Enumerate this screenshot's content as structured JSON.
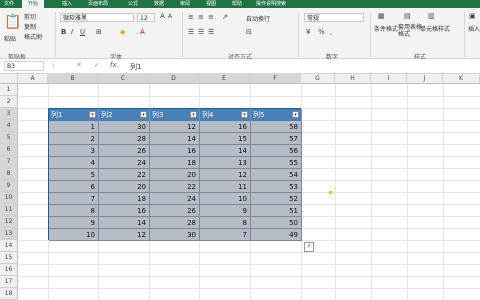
{
  "tabs": [
    "文件",
    "开始",
    "插入",
    "页面布局",
    "公式",
    "数据",
    "审阅",
    "视图",
    "帮助",
    "操作说明搜索"
  ],
  "ribbon": {
    "clipboard": {
      "paste": "粘贴",
      "cut": "剪切",
      "copy": "复制",
      "format_painter": "格式刷",
      "group": "剪贴板"
    },
    "font": {
      "name": "微软雅黑",
      "size": "12",
      "group": "字体"
    },
    "alignment": {
      "wrap": "自动换行",
      "group": "对齐方式"
    },
    "number": {
      "format": "常规",
      "group": "数字"
    },
    "styles": {
      "conditional": "条件格式",
      "table": "套用表格格式",
      "cell": "单元格样式",
      "group": "样式"
    },
    "cells": {
      "insert": "插入"
    }
  },
  "formula_bar": {
    "name_box": "B3",
    "fx": "fx",
    "content": "列1"
  },
  "columns": [
    "A",
    "B",
    "C",
    "D",
    "E",
    "F",
    "G",
    "H",
    "I",
    "J",
    "K"
  ],
  "rows": [
    "1",
    "2",
    "3",
    "4",
    "5",
    "6",
    "7",
    "8",
    "9",
    "10",
    "11",
    "12",
    "13",
    "14",
    "15",
    "16",
    "17",
    "18"
  ],
  "table": {
    "headers": [
      "列1",
      "列2",
      "列3",
      "列4",
      "列5"
    ],
    "rows": [
      [
        1,
        30,
        12,
        16,
        58
      ],
      [
        2,
        28,
        14,
        15,
        57
      ],
      [
        3,
        26,
        16,
        14,
        56
      ],
      [
        4,
        24,
        18,
        13,
        55
      ],
      [
        5,
        22,
        20,
        12,
        54
      ],
      [
        6,
        20,
        22,
        11,
        53
      ],
      [
        7,
        18,
        24,
        10,
        52
      ],
      [
        8,
        16,
        26,
        9,
        51
      ],
      [
        9,
        14,
        28,
        8,
        50
      ],
      [
        10,
        12,
        30,
        7,
        49
      ]
    ]
  },
  "colors": {
    "excel_green": "#217346",
    "table_header": "#4a7fb8",
    "table_body": "#b5bcc6"
  }
}
